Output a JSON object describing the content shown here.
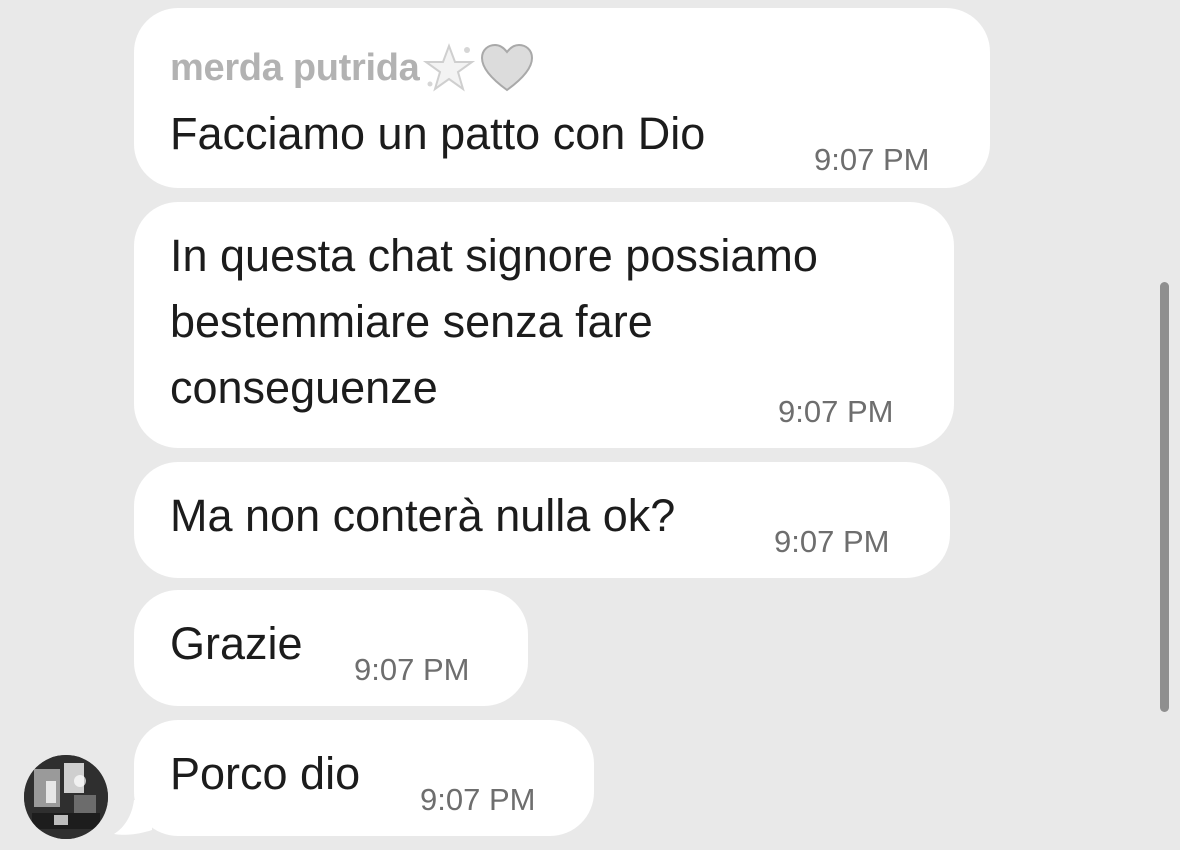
{
  "messages": [
    {
      "sender": "merda putrida",
      "sender_emojis": [
        "sparkle-star-icon",
        "white-heart-icon"
      ],
      "lines": [
        "Facciamo un patto con Dio"
      ],
      "time": "9:07 PM"
    },
    {
      "lines": [
        "In questa chat signore possiamo",
        "bestemmiare senza fare",
        "conseguenze"
      ],
      "time": "9:07 PM"
    },
    {
      "lines": [
        "Ma non conterà nulla ok?"
      ],
      "time": "9:07 PM"
    },
    {
      "lines": [
        "Grazie"
      ],
      "time": "9:07 PM"
    },
    {
      "lines": [
        "Porco dio"
      ],
      "time": "9:07 PM"
    }
  ],
  "colors": {
    "background": "#e9e9e9",
    "bubble": "#ffffff",
    "text": "#1c1c1c",
    "sender_name": "#b2b2b2",
    "timestamp": "#6e6e6e",
    "scrollbar": "#8f8f8f"
  }
}
